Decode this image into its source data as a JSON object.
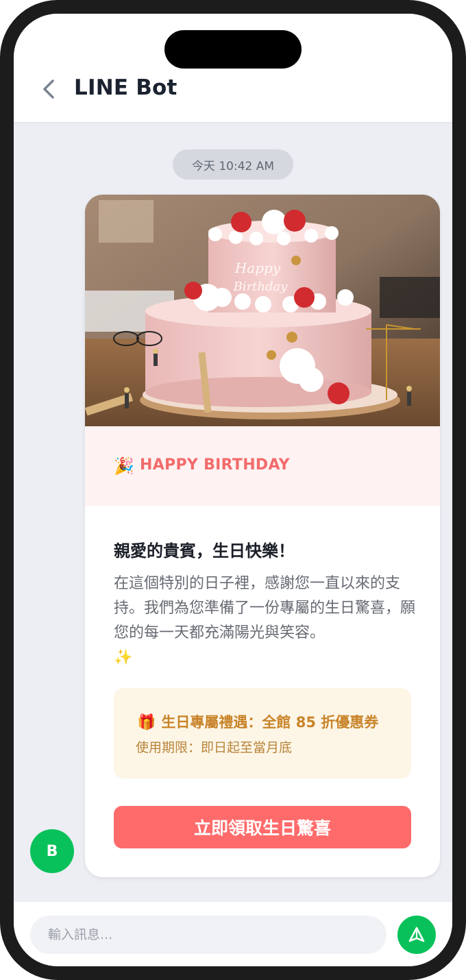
{
  "header": {
    "title": "LINE Bot"
  },
  "chat": {
    "timestamp": "今天 10:42 AM",
    "card": {
      "banner_emoji": "🎉",
      "banner_label": "HAPPY BIRTHDAY",
      "title": "親愛的貴賓，生日快樂！",
      "message": "在這個特別的日子裡，感謝您一直以來的支持。我們為您準備了一份專屬的生日驚喜，願您的每一天都充滿陽光與笑容。",
      "sparkle_emoji": "✨",
      "offer": {
        "gift_emoji": "🎁",
        "title": "生日專屬禮遇：全館 85 折優惠券",
        "validity": "使用期限：即日起至當月底"
      },
      "cta_label": "立即領取生日驚喜"
    },
    "bot_avatar_initial": "B"
  },
  "composer": {
    "placeholder": "輸入訊息..."
  },
  "colors": {
    "line_green": "#08c15a",
    "accent_red": "#ff6b6b",
    "banner_text": "#f26b6b",
    "offer_text": "#c8842a"
  },
  "icons": {
    "back": "chevron-left-icon",
    "send": "send-icon"
  }
}
